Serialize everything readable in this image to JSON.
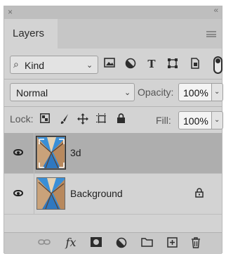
{
  "panel": {
    "close_glyph": "×",
    "collapse_glyph": "‹‹",
    "tab_label": "Layers",
    "menu_icon": "hamburger-menu-icon"
  },
  "filter": {
    "kind_label": "Kind",
    "search_glyph": "⌕",
    "chevron": "⌄",
    "icons": [
      "pixel-layer-filter-icon",
      "adjustment-layer-filter-icon",
      "type-layer-filter-icon",
      "shape-layer-filter-icon",
      "smart-object-filter-icon",
      "filter-toggle-icon"
    ]
  },
  "blend": {
    "mode": "Normal",
    "opacity_label": "Opacity:",
    "opacity_value": "100%"
  },
  "lock": {
    "label": "Lock:",
    "fill_label": "Fill:",
    "fill_value": "100%",
    "icons": [
      "lock-transparent-pixels-icon",
      "lock-image-pixels-icon",
      "lock-position-icon",
      "lock-artboard-icon",
      "lock-all-icon"
    ]
  },
  "layers": [
    {
      "name": "3d",
      "selected": true,
      "visible": true,
      "locked": false
    },
    {
      "name": "Background",
      "selected": false,
      "visible": true,
      "locked": true
    }
  ],
  "footer": {
    "fx_label": "fx",
    "icons": [
      "link-layers-icon",
      "layer-style-icon",
      "add-mask-icon",
      "adjustment-layer-icon",
      "group-folder-icon",
      "new-layer-icon",
      "trash-icon"
    ]
  },
  "colors": {
    "panel_bg": "#d3d3d3",
    "selected_row": "#aeaeae",
    "thumb_sky": "#3a8fd6"
  }
}
